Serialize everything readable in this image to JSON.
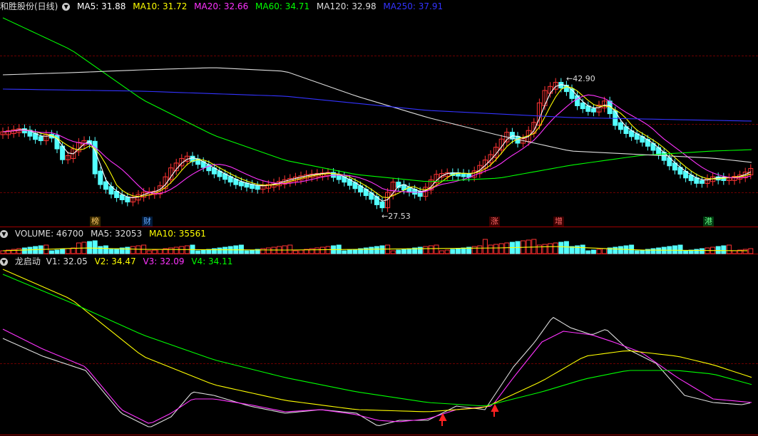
{
  "header": {
    "title": "和胜股份(日线)",
    "indicators": [
      {
        "label": "MA5: 31.88",
        "color": "#ffffff"
      },
      {
        "label": "MA10: 31.72",
        "color": "#ffff00"
      },
      {
        "label": "MA20: 32.66",
        "color": "#ff33ff"
      },
      {
        "label": "MA60: 34.71",
        "color": "#00ff00"
      },
      {
        "label": "MA120: 32.98",
        "color": "#dddddd"
      },
      {
        "label": "MA250: 37.91",
        "color": "#3333ff"
      }
    ],
    "high_label": "42.90",
    "low_label": "27.53"
  },
  "event_tags": [
    "榜",
    "财",
    "涨",
    "增",
    "港"
  ],
  "volume_header": {
    "items": [
      {
        "label": "VOLUME: 46700",
        "color": "#dddddd"
      },
      {
        "label": "MA5: 32053",
        "color": "#dddddd"
      },
      {
        "label": "MA10: 35561",
        "color": "#ffff00"
      }
    ]
  },
  "indicator_header": {
    "name": "龙启动",
    "items": [
      {
        "label": "V1: 32.05",
        "color": "#dddddd"
      },
      {
        "label": "V2: 34.47",
        "color": "#ffff00"
      },
      {
        "label": "V3: 32.09",
        "color": "#ff33ff"
      },
      {
        "label": "V4: 34.11",
        "color": "#00ff00"
      }
    ]
  },
  "colors": {
    "up": "#ff3333",
    "down": "#54ffff",
    "ma5": "#ffffff",
    "ma10": "#ffff00",
    "ma20": "#ff33ff",
    "ma60": "#00ff00",
    "ma120": "#dddddd",
    "ma250": "#3333ff"
  }
}
